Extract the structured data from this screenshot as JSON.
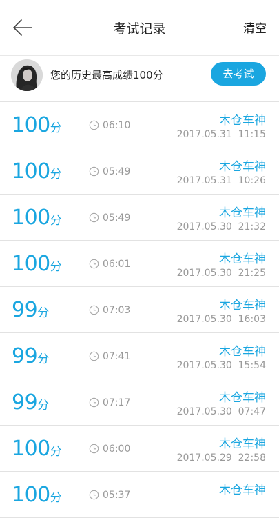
{
  "header": {
    "title": "考试记录",
    "clear_label": "清空"
  },
  "best": {
    "text": "您的历史最高成绩100分",
    "button_label": "去考试"
  },
  "records": [
    {
      "score": "100",
      "unit": "分",
      "duration": "06:10",
      "name": "木仓车神",
      "date": "2017.05.31  11:15"
    },
    {
      "score": "100",
      "unit": "分",
      "duration": "05:49",
      "name": "木仓车神",
      "date": "2017.05.31  10:26"
    },
    {
      "score": "100",
      "unit": "分",
      "duration": "05:49",
      "name": "木仓车神",
      "date": "2017.05.30  21:32"
    },
    {
      "score": "100",
      "unit": "分",
      "duration": "06:01",
      "name": "木仓车神",
      "date": "2017.05.30  21:25"
    },
    {
      "score": "99",
      "unit": "分",
      "duration": "07:03",
      "name": "木仓车神",
      "date": "2017.05.30  16:03"
    },
    {
      "score": "99",
      "unit": "分",
      "duration": "07:41",
      "name": "木仓车神",
      "date": "2017.05.30  15:54"
    },
    {
      "score": "99",
      "unit": "分",
      "duration": "07:17",
      "name": "木仓车神",
      "date": "2017.05.30  07:47"
    },
    {
      "score": "100",
      "unit": "分",
      "duration": "06:00",
      "name": "木仓车神",
      "date": "2017.05.29  22:58"
    },
    {
      "score": "100",
      "unit": "分",
      "duration": "05:37",
      "name": "木仓车神",
      "date": ""
    }
  ],
  "colors": {
    "accent": "#1aa6e0",
    "muted": "#999999",
    "divider": "#e2e2e2"
  },
  "icons": {
    "back": "arrow-left-icon",
    "clock": "clock-icon"
  }
}
